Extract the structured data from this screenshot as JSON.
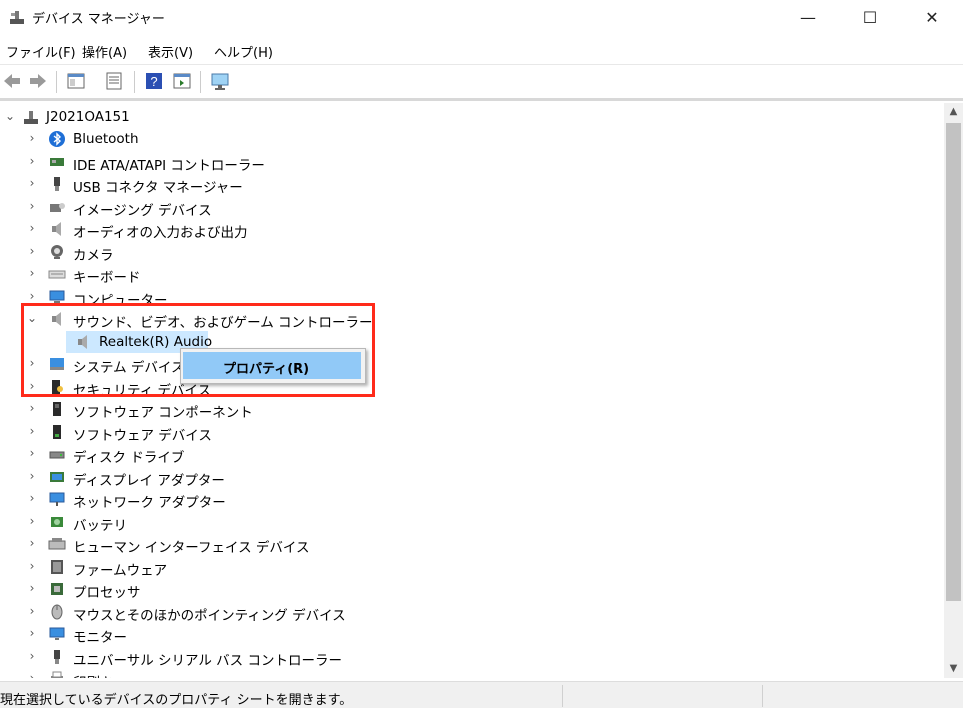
{
  "window": {
    "title": "デバイス マネージャー",
    "minimize": "—",
    "maximize": "☐",
    "close": "✕"
  },
  "menu": [
    "ファイル(F)",
    "操作(A)",
    "表示(V)",
    "ヘルプ(H)"
  ],
  "toolbar": [
    "back-icon",
    "forward-icon",
    "show-hide-tree-icon",
    "properties-icon",
    "help-icon",
    "action-pane-icon",
    "scan-hardware-icon"
  ],
  "tree": {
    "root": "J2021OA151",
    "items": [
      {
        "label": "Bluetooth",
        "icon": "bluetooth-icon"
      },
      {
        "label": "IDE ATA/ATAPI コントローラー",
        "icon": "ide-controller-icon"
      },
      {
        "label": "USB コネクタ マネージャー",
        "icon": "usb-connector-icon"
      },
      {
        "label": "イメージング デバイス",
        "icon": "imaging-device-icon"
      },
      {
        "label": "オーディオの入力および出力",
        "icon": "speaker-icon"
      },
      {
        "label": "カメラ",
        "icon": "camera-icon"
      },
      {
        "label": "キーボード",
        "icon": "keyboard-icon"
      },
      {
        "label": "コンピューター",
        "icon": "computer-icon"
      },
      {
        "label": "サウンド、ビデオ、およびゲーム コントローラー",
        "icon": "speaker-icon",
        "expanded": true
      },
      {
        "label": "Realtek(R) Audio",
        "icon": "speaker-icon",
        "child": true,
        "selected": true
      },
      {
        "label": "システム デバイス",
        "icon": "system-device-icon"
      },
      {
        "label": "セキュリティ デバイス",
        "icon": "security-device-icon"
      },
      {
        "label": "ソフトウェア コンポーネント",
        "icon": "software-component-icon"
      },
      {
        "label": "ソフトウェア デバイス",
        "icon": "software-device-icon"
      },
      {
        "label": "ディスク ドライブ",
        "icon": "disk-drive-icon"
      },
      {
        "label": "ディスプレイ アダプター",
        "icon": "display-adapter-icon"
      },
      {
        "label": "ネットワーク アダプター",
        "icon": "network-adapter-icon"
      },
      {
        "label": "バッテリ",
        "icon": "battery-icon"
      },
      {
        "label": "ヒューマン インターフェイス デバイス",
        "icon": "hid-icon"
      },
      {
        "label": "ファームウェア",
        "icon": "firmware-icon"
      },
      {
        "label": "プロセッサ",
        "icon": "processor-icon"
      },
      {
        "label": "マウスとそのほかのポインティング デバイス",
        "icon": "mouse-icon"
      },
      {
        "label": "モニター",
        "icon": "monitor-icon"
      },
      {
        "label": "ユニバーサル シリアル バス コントローラー",
        "icon": "usb-controller-icon"
      },
      {
        "label": "印刷キュー",
        "icon": "print-queue-icon"
      }
    ]
  },
  "context_menu": {
    "item": "プロパティ(R)"
  },
  "status": {
    "text": "現在選択しているデバイスのプロパティ シートを開きます。"
  },
  "colors": {
    "highlight_box": "#ff2a1a",
    "selection": "#cce8ff",
    "menu_hover": "#91c9f7"
  }
}
